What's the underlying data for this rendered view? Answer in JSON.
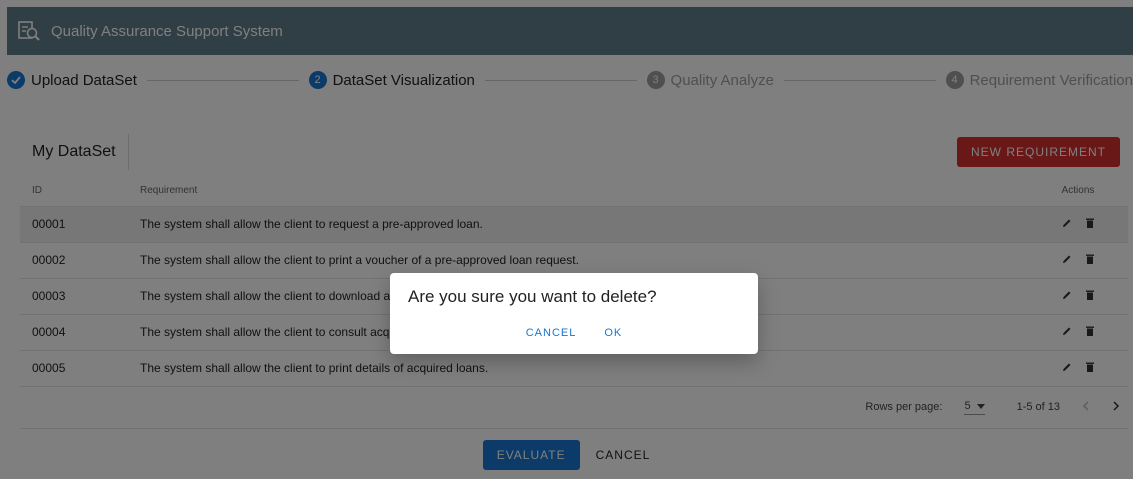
{
  "app": {
    "title": "Quality Assurance Support System"
  },
  "stepper": {
    "steps": [
      {
        "number": "",
        "label": "Upload DataSet",
        "state": "completed"
      },
      {
        "number": "2",
        "label": "DataSet Visualization",
        "state": "active"
      },
      {
        "number": "3",
        "label": "Quality Analyze",
        "state": "inactive"
      },
      {
        "number": "4",
        "label": "Requirement Verification",
        "state": "inactive"
      }
    ]
  },
  "dataset": {
    "title": "My DataSet",
    "new_button_label": "NEW REQUIREMENT",
    "columns": {
      "id": "ID",
      "requirement": "Requirement",
      "actions": "Actions"
    },
    "rows": [
      {
        "id": "00001",
        "requirement": "The system shall allow the client to request a pre-approved loan."
      },
      {
        "id": "00002",
        "requirement": "The system shall allow the client to print a voucher of a pre-approved loan request."
      },
      {
        "id": "00003",
        "requirement": "The system shall allow the client to download a vouc"
      },
      {
        "id": "00004",
        "requirement": "The system shall allow the client to consult acquired"
      },
      {
        "id": "00005",
        "requirement": "The system shall allow the client to print details of acquired loans."
      }
    ],
    "pagination": {
      "rows_per_page_label": "Rows per page:",
      "rows_per_page": "5",
      "range": "1-5 of 13"
    }
  },
  "footer": {
    "evaluate_label": "EVALUATE",
    "cancel_label": "CANCEL"
  },
  "dialog": {
    "message": "Are you sure you want to delete?",
    "cancel_label": "CANCEL",
    "ok_label": "OK"
  },
  "colors": {
    "appbar": "#607d8b",
    "primary": "#1976d2",
    "danger": "#d32f2f",
    "selected_row": "#eeeeee"
  }
}
